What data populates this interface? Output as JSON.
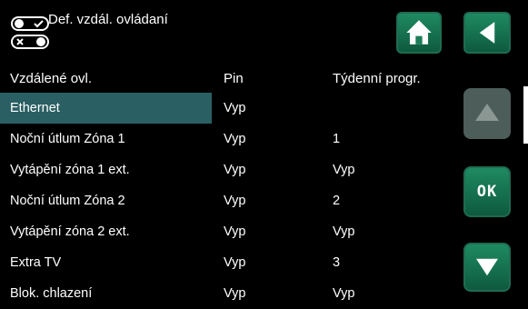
{
  "header": {
    "title": "Def. vzdál. ovládaní",
    "icon": "toggle-switches-icon"
  },
  "buttons": {
    "home_icon": "home-icon",
    "back_icon": "back-arrow-icon",
    "up_icon": "up-arrow-icon",
    "ok_label": "OK",
    "down_icon": "down-arrow-icon"
  },
  "columns": {
    "name": "Vzdálené ovl.",
    "pin": "Pin",
    "weekly": "Týdenní progr."
  },
  "rows": [
    {
      "name": "Ethernet",
      "pin": "Vyp",
      "weekly": ""
    },
    {
      "name": "Noční útlum Zóna 1",
      "pin": "Vyp",
      "weekly": "1"
    },
    {
      "name": "Vytápění zóna 1 ext.",
      "pin": "Vyp",
      "weekly": "Vyp"
    },
    {
      "name": "Noční útlum Zóna 2",
      "pin": "Vyp",
      "weekly": "2"
    },
    {
      "name": "Vytápění zóna 2 ext.",
      "pin": "Vyp",
      "weekly": "Vyp"
    },
    {
      "name": "Extra TV",
      "pin": "Vyp",
      "weekly": "3"
    },
    {
      "name": "Blok. chlazení",
      "pin": "Vyp",
      "weekly": "Vyp"
    }
  ],
  "colors": {
    "selected_row": "#2a5f63",
    "button_green": "#1e8a62",
    "button_disabled": "#4d5d59"
  }
}
